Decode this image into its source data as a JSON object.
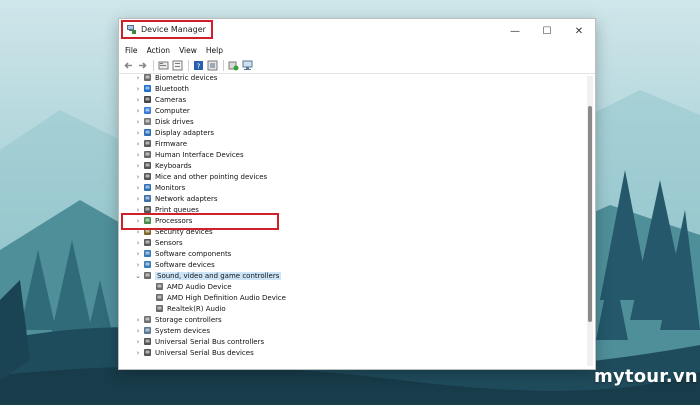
{
  "window": {
    "title": "Device Manager",
    "controls": {
      "minimize": "—",
      "maximize": "☐",
      "close": "✕"
    }
  },
  "menu": [
    "File",
    "Action",
    "View",
    "Help"
  ],
  "toolbar_icons": [
    "back-arrow-icon",
    "forward-arrow-icon",
    "properties-icon",
    "details-icon",
    "help-icon",
    "device-icon",
    "update-driver-icon",
    "scan-hardware-icon"
  ],
  "tree": [
    {
      "label": "Biometric devices",
      "expanded": false
    },
    {
      "label": "Bluetooth",
      "expanded": false
    },
    {
      "label": "Cameras",
      "expanded": false
    },
    {
      "label": "Computer",
      "expanded": false
    },
    {
      "label": "Disk drives",
      "expanded": false
    },
    {
      "label": "Display adapters",
      "expanded": false
    },
    {
      "label": "Firmware",
      "expanded": false
    },
    {
      "label": "Human Interface Devices",
      "expanded": false
    },
    {
      "label": "Keyboards",
      "expanded": false
    },
    {
      "label": "Mice and other pointing devices",
      "expanded": false
    },
    {
      "label": "Monitors",
      "expanded": false
    },
    {
      "label": "Network adapters",
      "expanded": false
    },
    {
      "label": "Print queues",
      "expanded": false
    },
    {
      "label": "Processors",
      "expanded": false
    },
    {
      "label": "Security devices",
      "expanded": false
    },
    {
      "label": "Sensors",
      "expanded": false
    },
    {
      "label": "Software components",
      "expanded": false
    },
    {
      "label": "Software devices",
      "expanded": false
    },
    {
      "label": "Sound, video and game controllers",
      "expanded": true,
      "selected": true,
      "children": [
        "AMD Audio Device",
        "AMD High Definition Audio Device",
        "Realtek(R) Audio"
      ]
    },
    {
      "label": "Storage controllers",
      "expanded": false
    },
    {
      "label": "System devices",
      "expanded": false
    },
    {
      "label": "Universal Serial Bus controllers",
      "expanded": false
    },
    {
      "label": "Universal Serial Bus devices",
      "expanded": false
    }
  ],
  "chevrons": {
    "collapsed": "›",
    "expanded": "⌄"
  },
  "colors": {
    "highlight": "#d0202b",
    "selection": "#cce4f7",
    "accent": "#0a64c8"
  },
  "watermark": "mytour.vn"
}
